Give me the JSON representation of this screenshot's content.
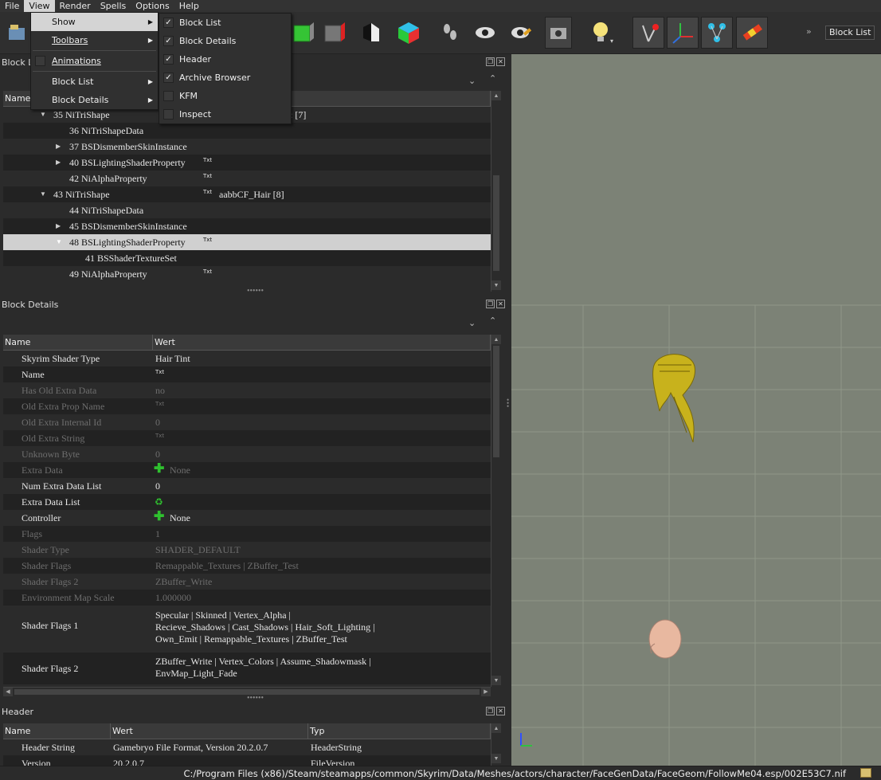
{
  "menubar": [
    "File",
    "View",
    "Render",
    "Spells",
    "Options",
    "Help"
  ],
  "view_menu": {
    "items": [
      {
        "label": "Show",
        "u": ""
      },
      {
        "label": "Toolbars",
        "u": "T"
      },
      {
        "label": "Animations",
        "u": "A"
      },
      {
        "label": "Block List"
      },
      {
        "label": "Block Details"
      }
    ]
  },
  "show_menu": [
    {
      "label": "Block List",
      "checked": true
    },
    {
      "label": "Block Details",
      "checked": true
    },
    {
      "label": "Header",
      "checked": true
    },
    {
      "label": "Archive Browser",
      "checked": true
    },
    {
      "label": "KFM",
      "checked": false
    },
    {
      "label": "Inspect",
      "checked": false
    }
  ],
  "toolbar": {
    "block_list_button": "Block List",
    "overflow": "»"
  },
  "block_list": {
    "title": "Block Li",
    "col_name": "Name",
    "rows": [
      {
        "text": "35 NiTriShape",
        "note": ": [7]",
        "expanded": true
      },
      {
        "text": "36 NiTriShapeData"
      },
      {
        "text": "37 BSDismemberSkinInstance",
        "collapsed": true
      },
      {
        "text": "40 BSLightingShaderProperty",
        "collapsed": true,
        "txt": "Txt"
      },
      {
        "text": "42 NiAlphaProperty",
        "txt": "Txt"
      },
      {
        "text": "43 NiTriShape",
        "expanded": true,
        "txt": "Txt",
        "note": "aabbCF_Hair [8]"
      },
      {
        "text": "44 NiTriShapeData"
      },
      {
        "text": "45 BSDismemberSkinInstance",
        "collapsed": true
      },
      {
        "text": "48 BSLightingShaderProperty",
        "expanded": true,
        "txt": "Txt",
        "selected": true
      },
      {
        "text": "41 BSShaderTextureSet"
      },
      {
        "text": "49 NiAlphaProperty",
        "txt": "Txt"
      }
    ]
  },
  "block_details": {
    "title": "Block Details",
    "col_name": "Name",
    "col_value": "Wert",
    "rows": [
      {
        "name": "Skyrim Shader Type",
        "value": "Hair Tint"
      },
      {
        "name": "Name",
        "value": "Txt",
        "icon": "txt"
      },
      {
        "name": "Has Old Extra Data",
        "value": "no",
        "dim": true
      },
      {
        "name": "Old Extra Prop Name",
        "value": "Txt",
        "icon": "txt",
        "dim": true
      },
      {
        "name": "Old Extra Internal Id",
        "value": "0",
        "dim": true
      },
      {
        "name": "Old Extra String",
        "value": "Txt",
        "icon": "txt",
        "dim": true
      },
      {
        "name": "Unknown Byte",
        "value": "0",
        "dim": true
      },
      {
        "name": "Extra Data",
        "value": "None",
        "icon": "plus",
        "dim": true
      },
      {
        "name": "Num Extra Data List",
        "value": "0"
      },
      {
        "name": "Extra Data List",
        "value": "",
        "icon": "recycle"
      },
      {
        "name": "Controller",
        "value": "None",
        "icon": "plus"
      },
      {
        "name": "Flags",
        "value": "1",
        "dim": true
      },
      {
        "name": "Shader Type",
        "value": "SHADER_DEFAULT",
        "dim": true
      },
      {
        "name": "Shader Flags",
        "value": "Remappable_Textures | ZBuffer_Test",
        "dim": true
      },
      {
        "name": "Shader Flags 2",
        "value": "ZBuffer_Write",
        "dim": true
      },
      {
        "name": "Environment Map Scale",
        "value": "1.000000",
        "dim": true
      }
    ],
    "flags1": {
      "name": "Shader Flags 1",
      "lines": [
        "Specular | Skinned | Vertex_Alpha |",
        "Recieve_Shadows | Cast_Shadows | Hair_Soft_Lighting |",
        "Own_Emit | Remappable_Textures | ZBuffer_Test"
      ]
    },
    "flags2": {
      "name": "Shader Flags 2",
      "lines": [
        "ZBuffer_Write | Vertex_Colors | Assume_Shadowmask |",
        "EnvMap_Light_Fade"
      ]
    }
  },
  "header": {
    "title": "Header",
    "col_name": "Name",
    "col_value": "Wert",
    "col_type": "Typ",
    "rows": [
      {
        "name": "Header String",
        "value": "Gamebryo File Format, Version 20.2.0.7",
        "type": "HeaderString"
      },
      {
        "name": "Version",
        "value": "20.2.0.7",
        "type": "FileVersion"
      }
    ]
  },
  "status": {
    "path": "C:/Program Files (x86)/Steam/steamapps/common/Skyrim/Data/Meshes/actors/character/FaceGenData/FaceGeom/FollowMe04.esp/002E53C7.nif"
  }
}
